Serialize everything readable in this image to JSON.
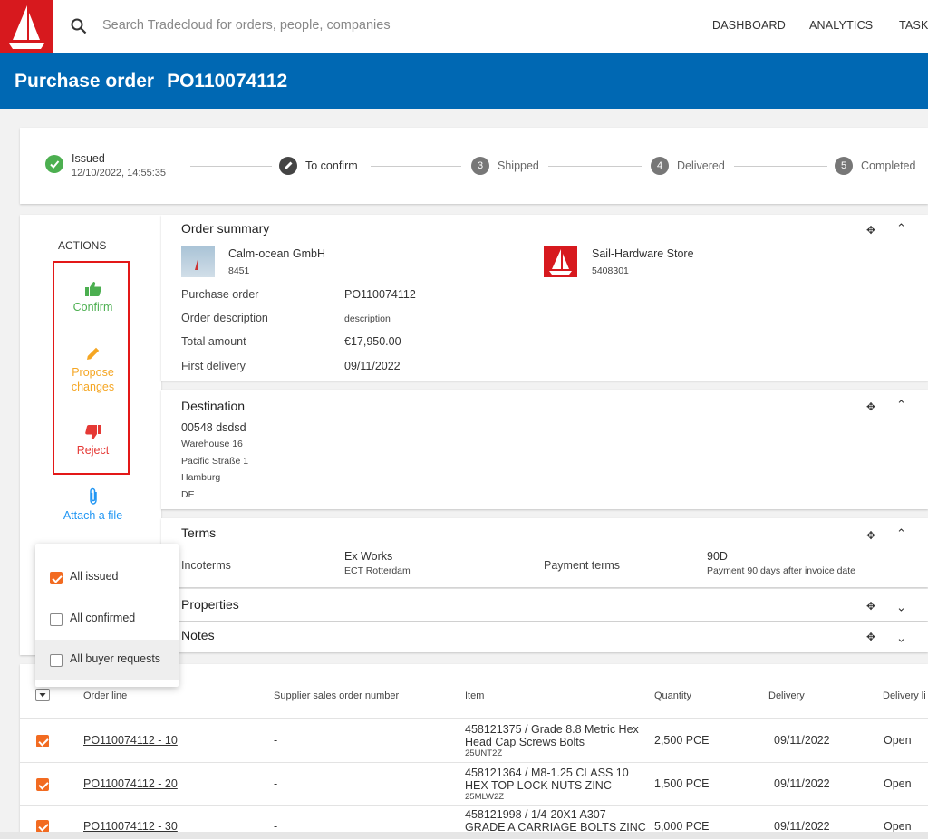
{
  "header": {
    "search_placeholder": "Search Tradecloud for orders, people, companies",
    "nav": [
      "DASHBOARD",
      "ANALYTICS",
      "TASK"
    ]
  },
  "title": {
    "label": "Purchase order",
    "po": "PO110074112"
  },
  "steps": [
    {
      "label": "Issued",
      "sub": "12/10/2022, 14:55:35",
      "state": "done"
    },
    {
      "label": "To confirm",
      "state": "current"
    },
    {
      "number": "3",
      "label": "Shipped",
      "state": "todo"
    },
    {
      "number": "4",
      "label": "Delivered",
      "state": "todo"
    },
    {
      "number": "5",
      "label": "Completed",
      "state": "todo"
    }
  ],
  "actions": {
    "title": "ACTIONS",
    "confirm": "Confirm",
    "propose_1": "Propose",
    "propose_2": "changes",
    "reject": "Reject",
    "attach": "Attach a file"
  },
  "summary": {
    "title": "Order summary",
    "buyer": {
      "name": "Calm-ocean GmbH",
      "id": "8451"
    },
    "supplier": {
      "name": "Sail-Hardware Store",
      "id": "5408301"
    },
    "rows": [
      {
        "label": "Purchase order",
        "value": "PO110074112"
      },
      {
        "label": "Order description",
        "value": "description"
      },
      {
        "label": "Total amount",
        "value": "€17,950.00"
      },
      {
        "label": "First delivery",
        "value": "09/11/2022"
      }
    ]
  },
  "destination": {
    "title": "Destination",
    "code": "00548 dsdsd",
    "lines": [
      "Warehouse 16",
      "Pacific Straße 1",
      "Hamburg",
      "DE"
    ]
  },
  "terms": {
    "title": "Terms",
    "incoterms_label": "Incoterms",
    "incoterms_value": "Ex Works",
    "incoterms_sub": "ECT Rotterdam",
    "payment_label": "Payment terms",
    "payment_value": "90D",
    "payment_sub": "Payment 90 days after invoice date"
  },
  "properties": {
    "title": "Properties"
  },
  "notes": {
    "title": "Notes"
  },
  "dropdown": [
    {
      "label": "All issued",
      "checked": true
    },
    {
      "label": "All confirmed",
      "checked": false
    },
    {
      "label": "All buyer requests",
      "checked": false
    }
  ],
  "table": {
    "headers": [
      "Order line",
      "Supplier sales order number",
      "Item",
      "Quantity",
      "Delivery",
      "Delivery li"
    ],
    "rows": [
      {
        "line": "PO110074112 - 10",
        "sso": "-",
        "item_1": "458121375 / Grade 8.8 Metric Hex",
        "item_2": "Head Cap Screws Bolts",
        "code": "25UNT2Z",
        "qty": "2,500 PCE",
        "delivery": "09/11/2022",
        "status": "Open"
      },
      {
        "line": "PO110074112 - 20",
        "sso": "-",
        "item_1": "458121364 / M8-1.25 CLASS 10",
        "item_2": "HEX TOP LOCK NUTS ZINC",
        "code": "25MLW2Z",
        "qty": "1,500 PCE",
        "delivery": "09/11/2022",
        "status": "Open"
      },
      {
        "line": "PO110074112 - 30",
        "sso": "-",
        "item_1": "458121998 / 1/4-20X1 A307",
        "item_2": "GRADE A CARRIAGE BOLTS ZINC",
        "code": "",
        "qty": "5,000 PCE",
        "delivery": "09/11/2022",
        "status": "Open"
      }
    ]
  },
  "colors": {
    "brand_red": "#d7191e",
    "title_blue": "#0068b3",
    "confirm_green": "#4caf50",
    "propose_orange": "#f5a623",
    "reject_red": "#e53935",
    "attach_blue": "#2196f3",
    "check_orange": "#f26b21"
  }
}
